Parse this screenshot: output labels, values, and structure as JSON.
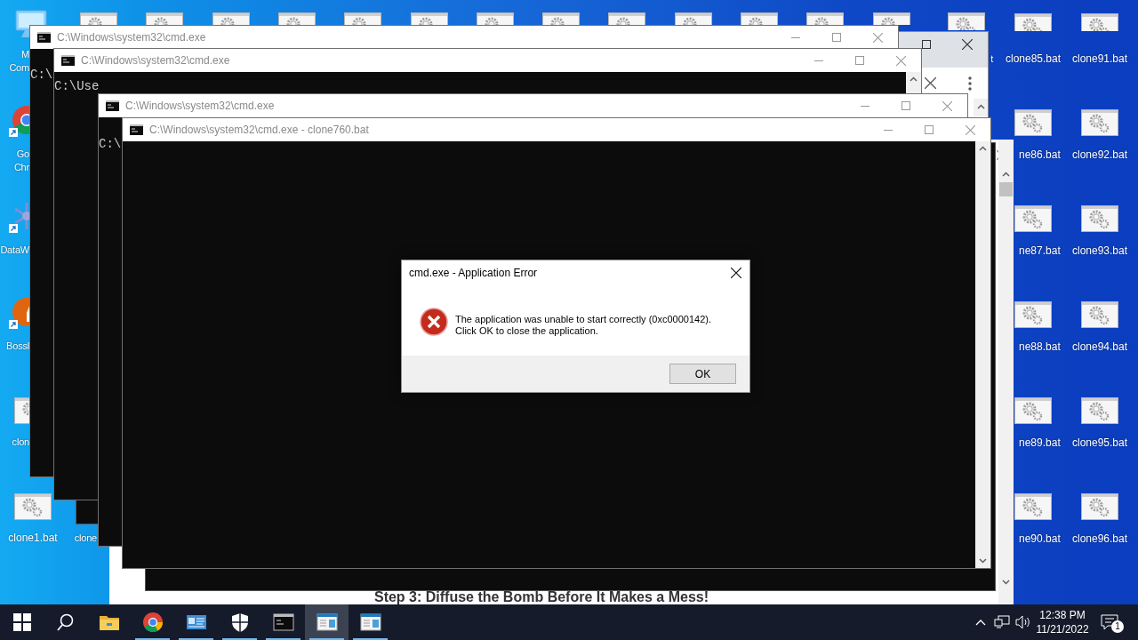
{
  "desktop_icons": [
    {
      "label": "M\nCom",
      "kind": "computer"
    },
    {
      "label": "Go\nChr",
      "kind": "chrome"
    },
    {
      "label": "DataW",
      "kind": "network"
    },
    {
      "label": "Bossl",
      "kind": "orange"
    },
    {
      "label": "clon",
      "kind": "bat"
    },
    {
      "label": "clone1.bat",
      "kind": "bat"
    },
    {
      "label": "clone",
      "kind": "label_only"
    },
    {
      "label": "t",
      "kind": "bat"
    },
    {
      "label": "clone85.bat",
      "kind": "bat"
    },
    {
      "label": "clone91.bat",
      "kind": "bat"
    },
    {
      "label": "ne86.bat",
      "kind": "bat"
    },
    {
      "label": "clone92.bat",
      "kind": "bat"
    },
    {
      "label": "ne87.bat",
      "kind": "bat"
    },
    {
      "label": "clone93.bat",
      "kind": "bat"
    },
    {
      "label": "ne88.bat",
      "kind": "bat"
    },
    {
      "label": "clone94.bat",
      "kind": "bat"
    },
    {
      "label": "ne89.bat",
      "kind": "bat"
    },
    {
      "label": "clone95.bat",
      "kind": "bat"
    },
    {
      "label": "ne90.bat",
      "kind": "bat"
    },
    {
      "label": "clone96.bat",
      "kind": "bat"
    }
  ],
  "webpage": {
    "heading": "Step 3: Diffuse the Bomb Before It Makes a Mess!"
  },
  "windows": [
    {
      "title": "C:\\Windows\\system32\\cmd.exe",
      "console": "C:\\"
    },
    {
      "title": "C:\\Windows\\system32\\cmd.exe",
      "console": "C:\\Use"
    },
    {
      "title": "C:\\Windows\\system32\\cmd.exe",
      "console": "C:\\"
    },
    {
      "title": "C:\\Windows\\system32\\cmd.exe - clone760.bat"
    }
  ],
  "dialog": {
    "title": "cmd.exe - Application Error",
    "message": "The application was unable to start correctly (0xc0000142).\nClick OK to close the application.",
    "button": "OK"
  },
  "taskbar": {
    "apps": [
      {
        "kind": "start",
        "running": false,
        "selected": false
      },
      {
        "kind": "search",
        "running": false,
        "selected": false
      },
      {
        "kind": "explorer",
        "running": false,
        "selected": false
      },
      {
        "kind": "chrome",
        "running": true,
        "selected": false
      },
      {
        "kind": "card",
        "running": true,
        "selected": false
      },
      {
        "kind": "shield",
        "running": true,
        "selected": false
      },
      {
        "kind": "cmd",
        "running": true,
        "selected": false
      },
      {
        "kind": "window",
        "running": true,
        "selected": true
      },
      {
        "kind": "window",
        "running": true,
        "selected": false
      }
    ],
    "time": "12:38 PM",
    "date": "11/21/2022",
    "notifications": "1"
  }
}
